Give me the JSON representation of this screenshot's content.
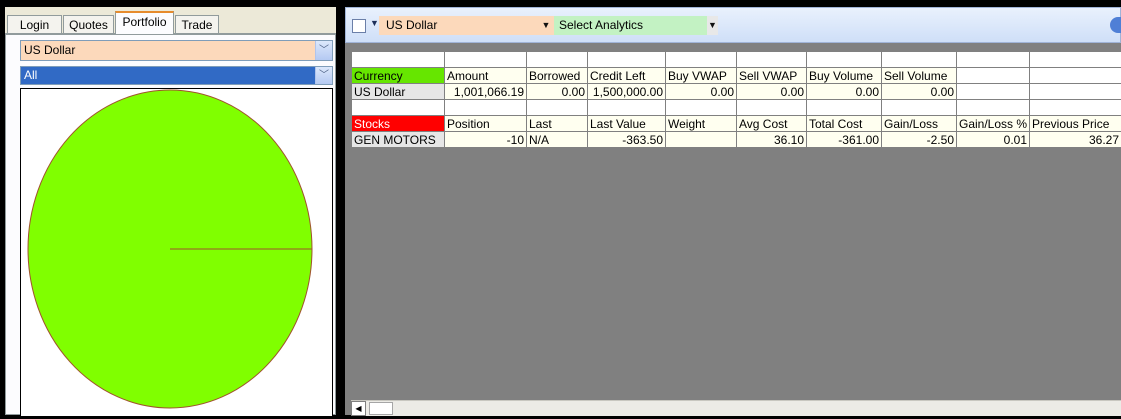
{
  "tabs": [
    {
      "label": "Login"
    },
    {
      "label": "Quotes"
    },
    {
      "label": "Portfolio"
    },
    {
      "label": "Trade"
    }
  ],
  "left": {
    "currency_select": "US Dollar",
    "filter_select": "All",
    "pie_color": "#80ff00"
  },
  "toolbar": {
    "currency": "US Dollar",
    "analytics": "Select Analytics"
  },
  "currency_table": {
    "section_label": "Currency",
    "headers": [
      "Amount",
      "Borrowed",
      "Credit Left",
      "Buy VWAP",
      "Sell VWAP",
      "Buy Volume",
      "Sell Volume"
    ],
    "rows": [
      {
        "name": "US Dollar",
        "cells": [
          "1,001,066.19",
          "0.00",
          "1,500,000.00",
          "0.00",
          "0.00",
          "0.00",
          "0.00"
        ]
      }
    ]
  },
  "stocks_table": {
    "section_label": "Stocks",
    "headers": [
      "Position",
      "Last",
      "Last Value",
      "Weight",
      "Avg Cost",
      "Total Cost",
      "Gain/Loss",
      "Gain/Loss %",
      "Previous Price"
    ],
    "rows": [
      {
        "name": "GEN MOTORS",
        "cells": [
          "-10",
          "N/A",
          "-363.50",
          "",
          "36.10",
          "-361.00",
          "-2.50",
          "0.01",
          "36.27"
        ]
      }
    ]
  },
  "colors": {
    "currency_label": "#66e600",
    "stocks_label": "#ff0000",
    "currency_select_bg": "#fcd9bb",
    "analytics_select_bg": "#c3f2c3"
  }
}
